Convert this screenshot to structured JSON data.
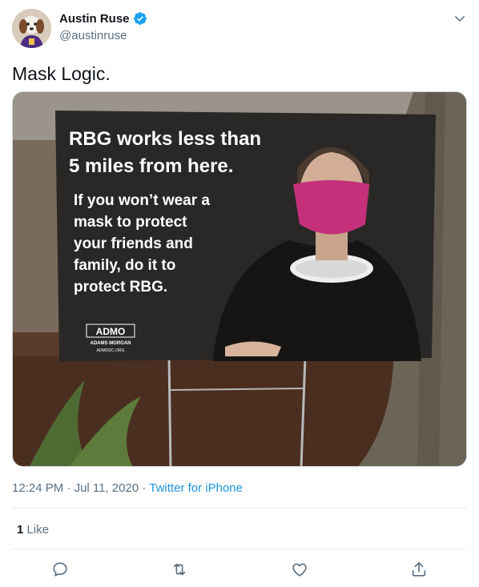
{
  "author": {
    "display_name": "Austin Ruse",
    "handle": "@austinruse",
    "verified": true
  },
  "tweet": {
    "text": "Mask Logic."
  },
  "media": {
    "sign": {
      "headline_line1": "RBG works less than",
      "headline_line2": "5 miles from here.",
      "body_line1": "If you won’t wear a",
      "body_line2": "mask to protect",
      "body_line3": "your friends and",
      "body_line4": "family, do it to",
      "body_line5": "protect RBG.",
      "logo_text": "ADMO",
      "logo_sub": "ADAMS MORGAN",
      "logo_url": "ADMODC.ORG"
    }
  },
  "meta": {
    "time": "12:24 PM",
    "separator1": " · ",
    "date": "Jul 11, 2020",
    "separator2": " · ",
    "source": "Twitter for iPhone"
  },
  "stats": {
    "likes_count": "1",
    "likes_label": "Like"
  },
  "colors": {
    "accent": "#1b95e0",
    "text_secondary": "#5b7083",
    "verified": "#1da1f2"
  },
  "icons": {
    "verified": "verified-badge-icon",
    "more": "chevron-down-icon",
    "reply": "reply-icon",
    "retweet": "retweet-icon",
    "like": "heart-icon",
    "share": "share-icon"
  }
}
